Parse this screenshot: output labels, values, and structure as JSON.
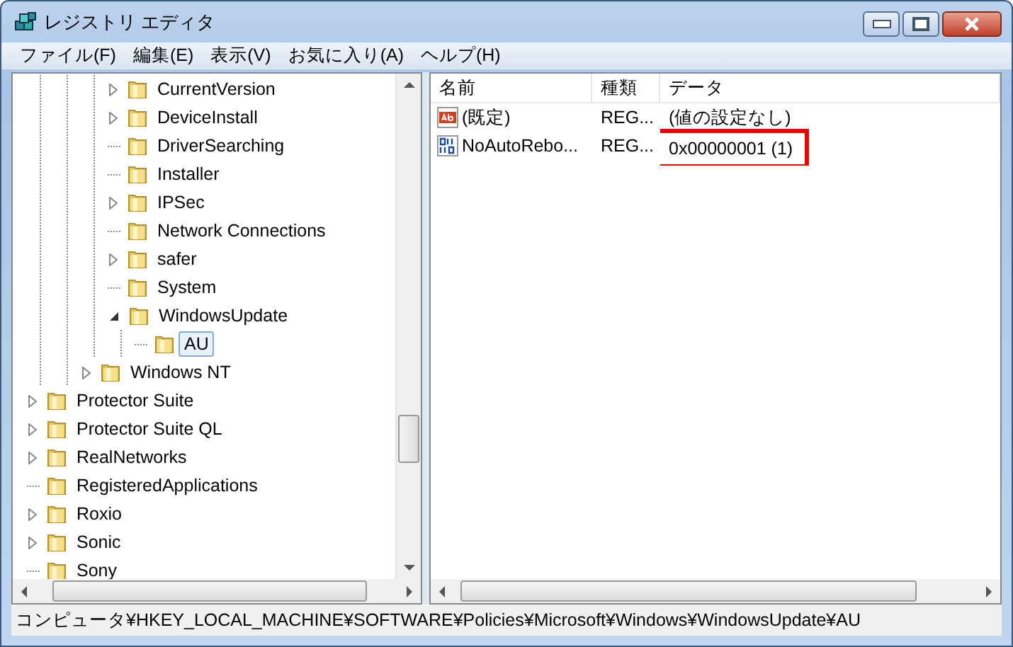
{
  "window": {
    "title": "レジストリ エディタ"
  },
  "menu": [
    "ファイル(F)",
    "編集(E)",
    "表示(V)",
    "お気に入り(A)",
    "ヘルプ(H)"
  ],
  "tree": [
    {
      "children": [
        {
          "children": [
            {
              "children": [
                {
                  "label": "CurrentVersion",
                  "expanded": false,
                  "selected": false
                },
                {
                  "label": "DeviceInstall",
                  "expanded": false,
                  "selected": false
                },
                {
                  "label": "DriverSearching",
                  "selected": false
                },
                {
                  "label": "Installer",
                  "selected": false
                },
                {
                  "label": "IPSec",
                  "expanded": false,
                  "selected": false
                },
                {
                  "label": "Network Connections",
                  "selected": false
                },
                {
                  "label": "safer",
                  "expanded": false,
                  "selected": false
                },
                {
                  "label": "System",
                  "selected": false
                },
                {
                  "label": "WindowsUpdate",
                  "expanded": true,
                  "selected": false,
                  "children": [
                    {
                      "label": "AU",
                      "selected": true
                    }
                  ]
                }
              ]
            },
            {
              "label": "Windows NT",
              "expanded": false,
              "selected": false
            }
          ]
        }
      ]
    },
    {
      "label": "Protector Suite",
      "expanded": false,
      "selected": false
    },
    {
      "label": "Protector Suite QL",
      "expanded": false,
      "selected": false
    },
    {
      "label": "RealNetworks",
      "expanded": false,
      "selected": false
    },
    {
      "label": "RegisteredApplications",
      "selected": false
    },
    {
      "label": "Roxio",
      "expanded": false,
      "selected": false
    },
    {
      "label": "Sonic",
      "expanded": false,
      "selected": false
    },
    {
      "label": "Sony",
      "selected": false
    }
  ],
  "values": {
    "columns": [
      "名前",
      "種類",
      "データ"
    ],
    "rows": [
      {
        "kind": "string",
        "name": "(既定)",
        "type": "REG...",
        "data": "(値の設定なし)",
        "highlighted": false
      },
      {
        "kind": "binary",
        "name": "NoAutoRebo...",
        "type": "REG...",
        "data": "0x00000001 (1)",
        "highlighted": true
      }
    ]
  },
  "status_bar": "コンピュータ¥HKEY_LOCAL_MACHINE¥SOFTWARE¥Policies¥Microsoft¥Windows¥WindowsUpdate¥AU"
}
